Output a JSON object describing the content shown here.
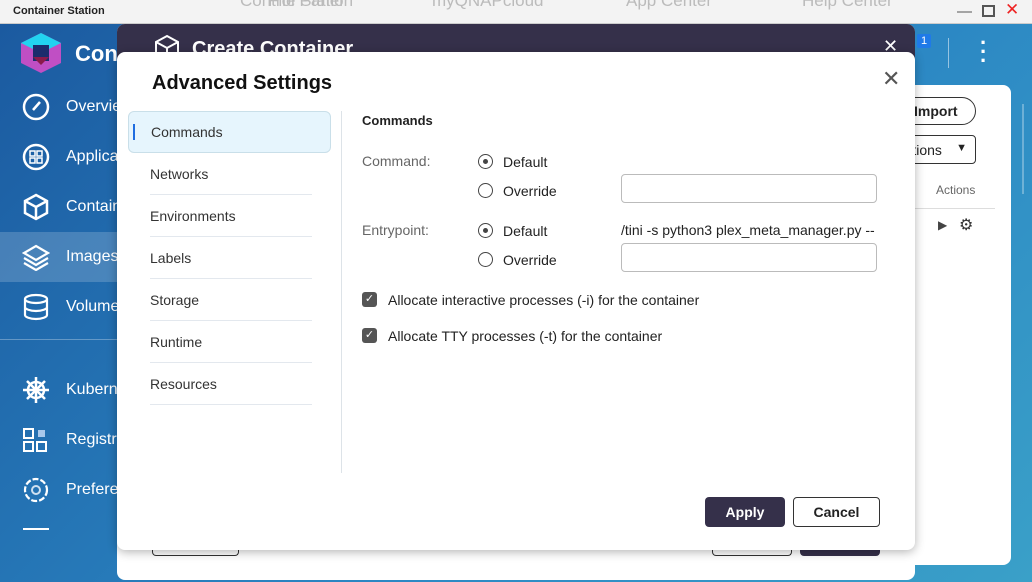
{
  "os": {
    "window_title": "Container Station",
    "background_apps": [
      "Control Panel",
      "File Station",
      "myQNAPcloud",
      "App Center",
      "Help Center"
    ]
  },
  "app": {
    "name": "Container Station",
    "notification_count": "1",
    "sidebar": [
      {
        "label": "Overview",
        "icon": "gauge-icon"
      },
      {
        "label": "Applications",
        "icon": "grid-icon"
      },
      {
        "label": "Containers",
        "icon": "cube-icon"
      },
      {
        "label": "Images",
        "icon": "layers-icon",
        "selected": true
      },
      {
        "label": "Volumes",
        "icon": "database-icon"
      },
      {
        "label": "Kubernetes",
        "icon": "helm-icon"
      },
      {
        "label": "Registries",
        "icon": "registry-icon"
      },
      {
        "label": "Preferences",
        "icon": "gear-icon"
      }
    ],
    "right_panel": {
      "import_label": "Import",
      "actions_dropdown": "Actions",
      "column_actions": "Actions"
    }
  },
  "create_dialog": {
    "title": "Create Container"
  },
  "advanced": {
    "title": "Advanced Settings",
    "nav": [
      {
        "label": "Commands",
        "selected": true
      },
      {
        "label": "Networks"
      },
      {
        "label": "Environments"
      },
      {
        "label": "Labels"
      },
      {
        "label": "Storage"
      },
      {
        "label": "Runtime"
      },
      {
        "label": "Resources"
      }
    ],
    "section_title": "Commands",
    "command": {
      "label": "Command:",
      "default_label": "Default",
      "override_label": "Override",
      "selected": "Default",
      "override_value": ""
    },
    "entrypoint": {
      "label": "Entrypoint:",
      "default_label": "Default",
      "override_label": "Override",
      "selected": "Default",
      "default_value": "/tini -s python3 plex_meta_manager.py --",
      "override_value": ""
    },
    "interactive": {
      "label": "Allocate interactive processes (-i) for the container",
      "checked": true
    },
    "tty": {
      "label": "Allocate TTY processes (-t) for the container",
      "checked": true
    },
    "apply_label": "Apply",
    "cancel_label": "Cancel"
  },
  "colors": {
    "dialog_header": "#35304a",
    "selected_nav_bg": "#e6f5fd",
    "accent": "#1f6de0"
  }
}
